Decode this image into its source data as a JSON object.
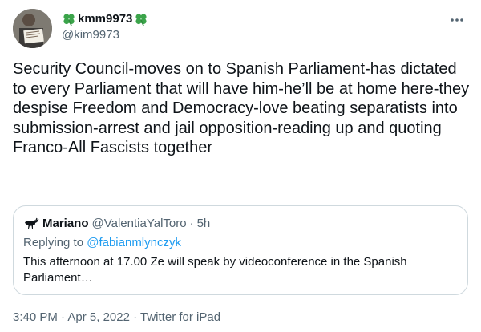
{
  "author": {
    "display_name": "kmm9973",
    "handle": "@kim9973",
    "avatar_icon": "profile-photo",
    "name_decoration_icon": "shamrock-icon"
  },
  "more_icon": "more-horizontal-icon",
  "tweet": {
    "text": "Security Council-moves on to Spanish Parliament-has dictated to every Parliament that will have him-he’ll be at home here-they despise Freedom and Democracy-love beating separatists into submission-arrest and jail opposition-reading up and quoting Franco-All Fascists together"
  },
  "quoted_tweet": {
    "display_name": "Mariano",
    "handle": "@ValentiaYalToro",
    "separator": "·",
    "time": "5h",
    "replying_to_prefix": "Replying to ",
    "replying_to_handle": "@fabianmlynczyk",
    "text": "This afternoon at 17.00 Ze will speak by videoconference in the Spanish Parliament…"
  },
  "meta": {
    "time": "3:40 PM",
    "separator": " · ",
    "date": "Apr 5, 2022",
    "source": "Twitter for iPad"
  },
  "colors": {
    "text_primary": "#0f1419",
    "text_secondary": "#536471",
    "link": "#1d9bf0",
    "border": "#cfd9de",
    "shamrock": "#3ba44a"
  }
}
